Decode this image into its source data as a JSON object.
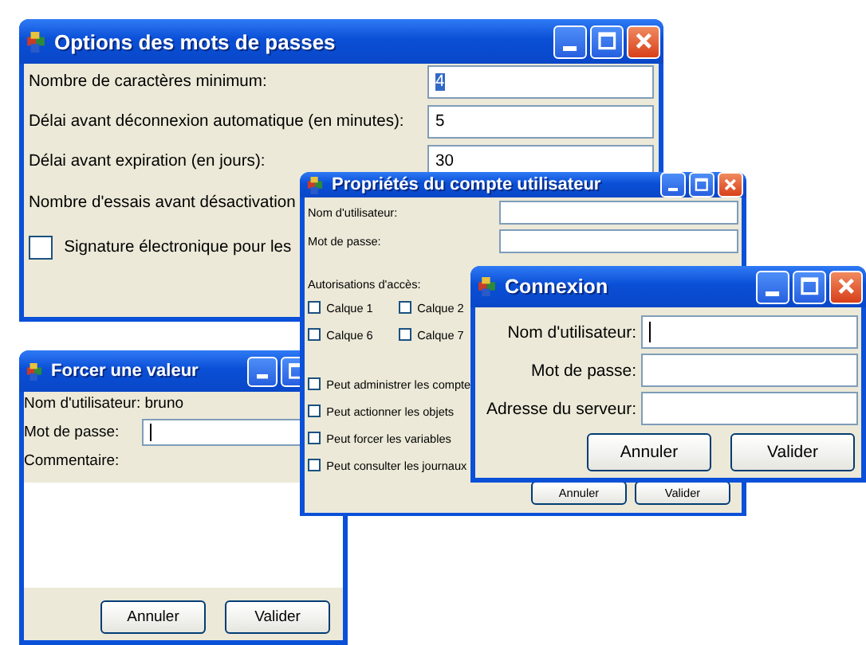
{
  "windows": [
    {
      "title": "Options des mots de passes",
      "items": [
        {
          "kind": "field",
          "label": "Nombre de caractères minimum:",
          "value": "4",
          "value_selected": true,
          "focused": false
        },
        {
          "kind": "field",
          "label": "Délai avant déconnexion automatique (en minutes):",
          "value": "5",
          "value_selected": false,
          "focused": false
        },
        {
          "kind": "field",
          "label": "Délai avant expiration (en jours):",
          "value": "30",
          "value_selected": false,
          "focused": false
        },
        {
          "kind": "text",
          "text": "Nombre d'essais avant désactivation"
        },
        {
          "kind": "checkbox",
          "label": "Signature électronique pour les",
          "checked": false
        }
      ]
    },
    {
      "title": "Forcer une valeur",
      "items": [
        {
          "kind": "text",
          "text": "Nom d'utilisateur: bruno"
        },
        {
          "kind": "field",
          "label": "Mot de passe:",
          "focused": true
        },
        {
          "kind": "text",
          "text": "Commentaire:"
        },
        {
          "kind": "area"
        },
        {
          "kind": "buttons",
          "buttons": [
            "Annuler",
            "Valider"
          ]
        }
      ]
    },
    {
      "title": "Propriétés du compte utilisateur",
      "items": [
        {
          "kind": "field",
          "label": "Nom d'utilisateur:",
          "focused": false
        },
        {
          "kind": "field",
          "label": "Mot de passe:",
          "focused": false
        },
        {
          "kind": "heading",
          "text": "Autorisations d'accès:"
        },
        {
          "kind": "checkgrid",
          "checks": [
            {
              "label": "Calque 1",
              "checked": false
            },
            {
              "label": "Calque 2",
              "checked": false
            },
            {
              "label": "Calque 6",
              "checked": false
            },
            {
              "label": "Calque 7",
              "checked": false
            }
          ]
        },
        {
          "kind": "checkbox",
          "label": "Peut administrer les compte",
          "checked": false
        },
        {
          "kind": "checkbox",
          "label": "Peut actionner les objets",
          "checked": false
        },
        {
          "kind": "checkbox",
          "label": "Peut forcer les variables",
          "checked": false
        },
        {
          "kind": "checkbox",
          "label": "Peut consulter les journaux",
          "checked": false
        },
        {
          "kind": "buttons",
          "buttons": [
            "Annuler",
            "Valider"
          ]
        }
      ]
    },
    {
      "title": "Connexion",
      "items": [
        {
          "kind": "field",
          "label": "Nom d'utilisateur:",
          "focused": true
        },
        {
          "kind": "field",
          "label": "Mot de passe:",
          "focused": false
        },
        {
          "kind": "field",
          "label": "Adresse du serveur:",
          "focused": false
        },
        {
          "kind": "buttons",
          "buttons": [
            "Annuler",
            "Valider"
          ]
        }
      ]
    }
  ]
}
